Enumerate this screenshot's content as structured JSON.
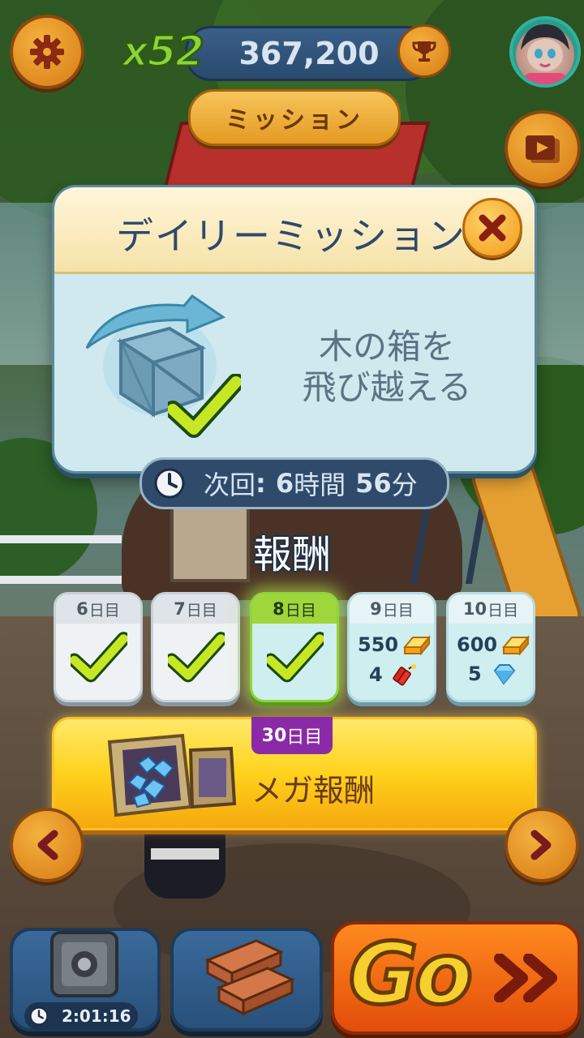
{
  "hud": {
    "multiplier": "x52",
    "score": "367,200",
    "mission_button": "ミッション"
  },
  "dialog": {
    "title": "デイリーミッション",
    "mission_line1": "木の箱を",
    "mission_line2": "飛び越える",
    "timer_label": "次回",
    "timer_hours": "6",
    "timer_hours_unit": "時間",
    "timer_minutes": "56",
    "timer_minutes_unit": "分"
  },
  "rewards": {
    "title": "報酬",
    "day_unit": "日目",
    "days": [
      {
        "day": "6",
        "state": "done"
      },
      {
        "day": "7",
        "state": "done"
      },
      {
        "day": "8",
        "state": "done",
        "current": true
      },
      {
        "day": "9",
        "state": "future",
        "coins": "550",
        "item_count": "4",
        "item": "dynamite-icon"
      },
      {
        "day": "10",
        "state": "future",
        "coins": "600",
        "item_count": "5",
        "item": "diamond-icon"
      }
    ],
    "mega_day": "30",
    "mega_label": "メガ報酬"
  },
  "bottom": {
    "safe_timer": "2:01:16",
    "go_label": "Go"
  },
  "colors": {
    "accent_orange": "#f29a18",
    "panel_blue": "#cfe9ef",
    "check_green": "#b6e020",
    "mega_gold": "#ffd21c"
  }
}
